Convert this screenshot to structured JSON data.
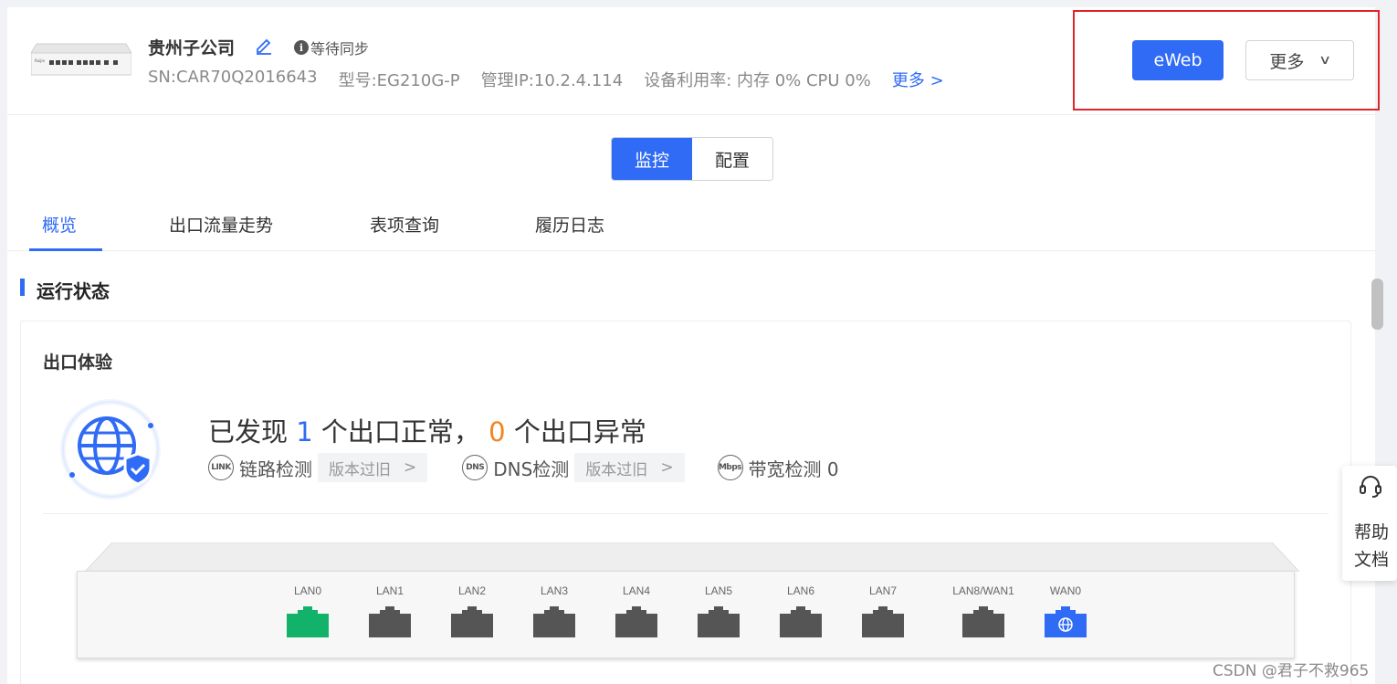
{
  "device": {
    "name": "贵州子公司",
    "sync_status": "等待同步",
    "sn": "SN:CAR70Q2016643",
    "model": "型号:EG210G-P",
    "mgmt_ip": "管理IP:10.2.4.114",
    "utilization": "设备利用率: 内存 0% CPU 0%",
    "more_link": "更多 >",
    "brand": "Ruijie"
  },
  "actions": {
    "eweb_label": "eWeb",
    "more_label": "更多",
    "more_chevron": "∨"
  },
  "segment": {
    "monitor": "监控",
    "config": "配置"
  },
  "tabs": [
    "概览",
    "出口流量走势",
    "表项查询",
    "履历日志"
  ],
  "section": {
    "title": "运行状态",
    "panel_title": "出口体验"
  },
  "summary": {
    "prefix": "已发现",
    "normal_count": "1",
    "normal_text": "个出口正常，",
    "abnormal_count": "0",
    "abnormal_text": "个出口异常"
  },
  "detections": {
    "link_icon": "LINK",
    "link_label": "链路检测",
    "link_tag": "版本过旧",
    "dns_icon": "DNS",
    "dns_label": "DNS检测",
    "dns_tag": "版本过旧",
    "bw_icon": "Mbps",
    "bw_label": "带宽检测 0",
    "tag_chevron": ">"
  },
  "ports": [
    {
      "label": "LAN0",
      "status": "up"
    },
    {
      "label": "LAN1",
      "status": "down"
    },
    {
      "label": "LAN2",
      "status": "down"
    },
    {
      "label": "LAN3",
      "status": "down"
    },
    {
      "label": "LAN4",
      "status": "down"
    },
    {
      "label": "LAN5",
      "status": "down"
    },
    {
      "label": "LAN6",
      "status": "down"
    },
    {
      "label": "LAN7",
      "status": "down"
    },
    {
      "label": "LAN8/WAN1",
      "status": "down"
    },
    {
      "label": "WAN0",
      "status": "wan"
    }
  ],
  "colors": {
    "accent": "#2f6bf5",
    "port_up": "#13b26b",
    "port_down": "#555555",
    "port_wan": "#2f6bf5",
    "warning": "#f6821f",
    "highlight_box": "#e0242b"
  },
  "help": {
    "label": "帮助文档"
  },
  "watermark": "CSDN @君子不救965"
}
